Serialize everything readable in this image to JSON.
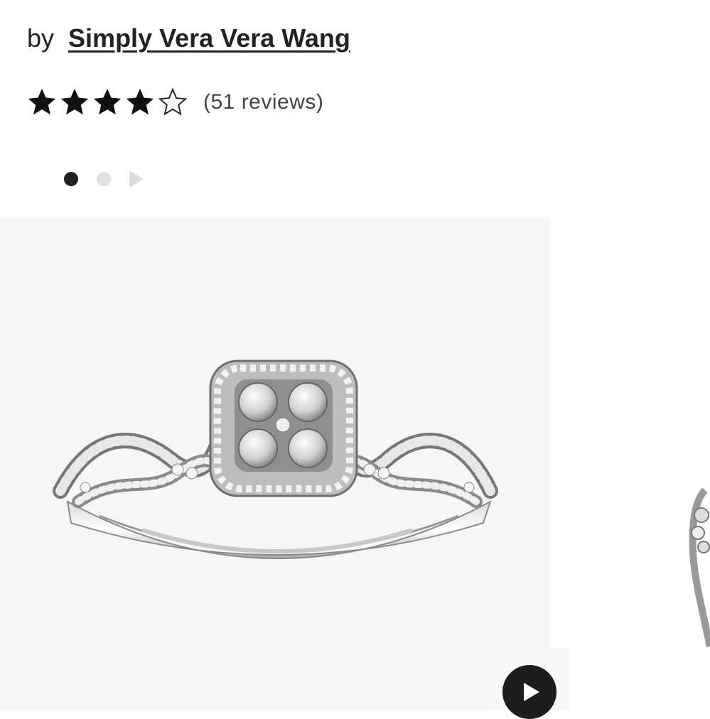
{
  "product": {
    "by_prefix": "by",
    "brand": "Simply Vera Vera Wang",
    "rating": {
      "value": 4,
      "max": 5,
      "reviews_label": "(51 reviews)"
    }
  },
  "gallery": {
    "dots": [
      {
        "active": true
      },
      {
        "active": false
      }
    ],
    "image_icon": "ring-image",
    "video_icon": "play-icon"
  }
}
